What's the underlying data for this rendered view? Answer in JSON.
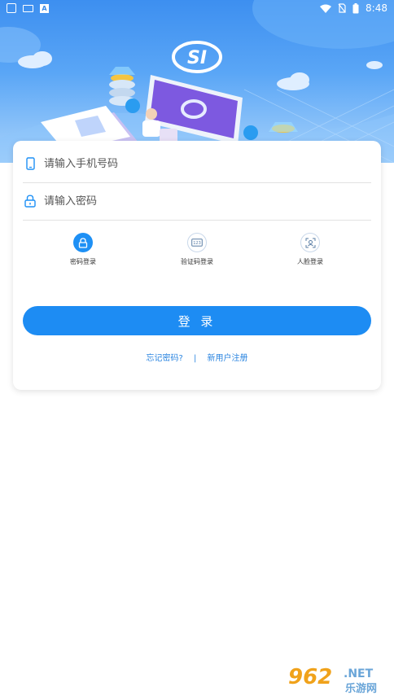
{
  "status_bar": {
    "time": "8:48",
    "left_icons": [
      "square-icon",
      "keyboard-icon",
      "a-icon"
    ],
    "right_icons": [
      "wifi-icon",
      "no-sim-icon",
      "battery-icon"
    ]
  },
  "hero": {
    "logo_text": "SI"
  },
  "form": {
    "phone_placeholder": "请输入手机号码",
    "password_placeholder": "请输入密码"
  },
  "login_modes": [
    {
      "label": "密码登录",
      "icon": "lock-icon",
      "active": true
    },
    {
      "label": "验证码登录",
      "icon": "code-icon",
      "active": false
    },
    {
      "label": "人脸登录",
      "icon": "face-icon",
      "active": false
    }
  ],
  "login_button_label": "登 录",
  "links": {
    "forgot": "忘记密码?",
    "separator": "|",
    "register": "新用户注册"
  },
  "watermark": {
    "text_main": "962",
    "text_net": ".NET",
    "text_sub": "乐游网"
  },
  "colors": {
    "accent": "#1d8cf3",
    "hero_top": "#3d8ff0"
  }
}
